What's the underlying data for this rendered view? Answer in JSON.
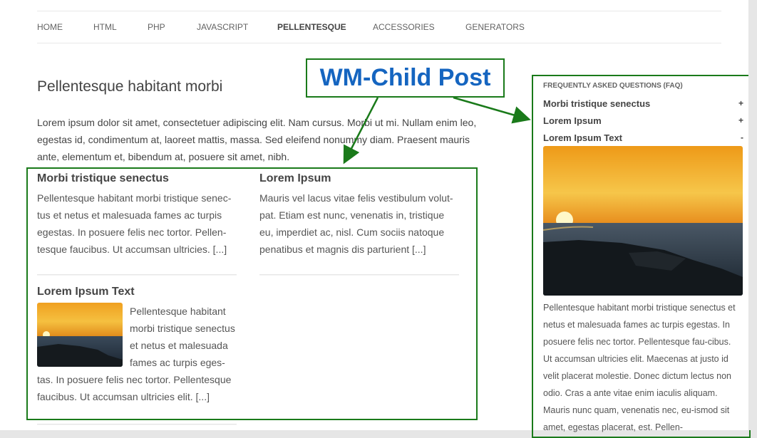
{
  "nav": {
    "items": [
      {
        "label": "HOME",
        "active": false
      },
      {
        "label": "HTML",
        "active": false
      },
      {
        "label": "PHP",
        "active": false
      },
      {
        "label": "JAVASCRIPT",
        "active": false
      },
      {
        "label": "PELLENTESQUE",
        "active": true
      },
      {
        "label": "ACCESSORIES",
        "active": false
      },
      {
        "label": "GENERATORS",
        "active": false
      }
    ]
  },
  "page": {
    "title": "Pellentesque habitant morbi",
    "intro": "Lorem ipsum dolor sit amet, consectetuer adipiscing elit. Nam cursus. Morbi ut mi. Nullam enim leo, egestas id, condimentum at, laoreet mattis, massa. Sed eleifend nonummy diam. Praesent mauris ante, elementum et, bibendum at, posuere sit amet, nibh."
  },
  "callout": {
    "label": "WM-Child Post",
    "color": "#1565c0",
    "border_color": "#1a7a1a"
  },
  "child_posts": [
    {
      "title": "Morbi tristique senectus",
      "excerpt": "Pellentesque habitant morbi tristique senec-tus et netus et malesuada fames ac turpis egestas. In posuere felis nec tortor. Pellen-tesque faucibus. Ut accumsan ultricies. [...]"
    },
    {
      "title": "Lorem Ipsum",
      "excerpt": "Mauris vel lacus vitae felis vestibulum volut-pat. Etiam est nunc, venenatis in, tristique eu, imperdiet ac, nisl. Cum sociis natoque penatibus et magnis dis parturient [...]"
    },
    {
      "title": "Lorem Ipsum Text",
      "excerpt_wrap": [
        "Pellentesque habitant",
        "morbi tristique senectus",
        "et netus et malesuada",
        "fames ac turpis eges-"
      ],
      "excerpt_rest": "tas. In posuere felis nec tortor. Pellentesque faucibus. Ut accumsan ultricies elit. [...]",
      "thumbnail": "sunset-image"
    }
  ],
  "faq": {
    "heading": "FREQUENTLY ASKED QUESTIONS (FAQ)",
    "items": [
      {
        "question": "Morbi tristique senectus",
        "toggle": "+"
      },
      {
        "question": "Lorem Ipsum",
        "toggle": "+"
      },
      {
        "question": "Lorem Ipsum Text",
        "toggle": "-"
      }
    ],
    "image": "sunset-image",
    "answer": "Pellentesque habitant morbi tristique senectus et netus et malesuada fames ac turpis egestas. In posuere felis nec tortor. Pellentesque fau-cibus. Ut accumsan ultricies elit. Maecenas at justo id velit placerat molestie. Donec dictum lectus non odio. Cras a ante vitae enim iaculis aliquam. Mauris nunc quam, venenatis nec, eu-ismod sit amet, egestas placerat, est. Pellen-"
  },
  "colors": {
    "annotation_green": "#1a7a1a",
    "callout_blue": "#1565c0",
    "text": "#444444"
  }
}
